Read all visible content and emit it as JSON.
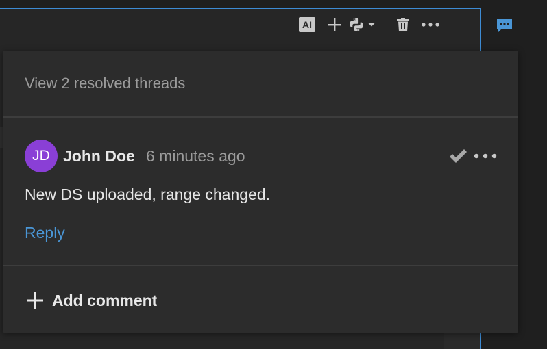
{
  "toolbar": {
    "ai_label": "AI",
    "buttons": [
      {
        "name": "ai-assist-button",
        "icon": "ai-icon"
      },
      {
        "name": "add-cell-button",
        "icon": "plus-icon"
      },
      {
        "name": "python-language-button",
        "icon": "python-icon"
      },
      {
        "name": "delete-cell-button",
        "icon": "trash-icon"
      },
      {
        "name": "more-options-button",
        "icon": "ellipsis-icon"
      }
    ]
  },
  "comments_toggle": {
    "icon": "comment-icon",
    "color": "#4a96d6"
  },
  "popup": {
    "resolved_threads_text": "View 2 resolved threads",
    "comment": {
      "avatar_initials": "JD",
      "avatar_color": "#8a3fd6",
      "author": "John Doe",
      "timestamp": "6 minutes ago",
      "body": "New DS uploaded, range changed.",
      "resolve_icon": "checkmark-icon",
      "more_icon": "ellipsis-icon"
    },
    "reply_label": "Reply",
    "add_comment_label": "Add comment"
  },
  "colors": {
    "accent": "#3d8bd4",
    "link": "#4a96d6",
    "popup_bg": "#2c2c2c"
  }
}
